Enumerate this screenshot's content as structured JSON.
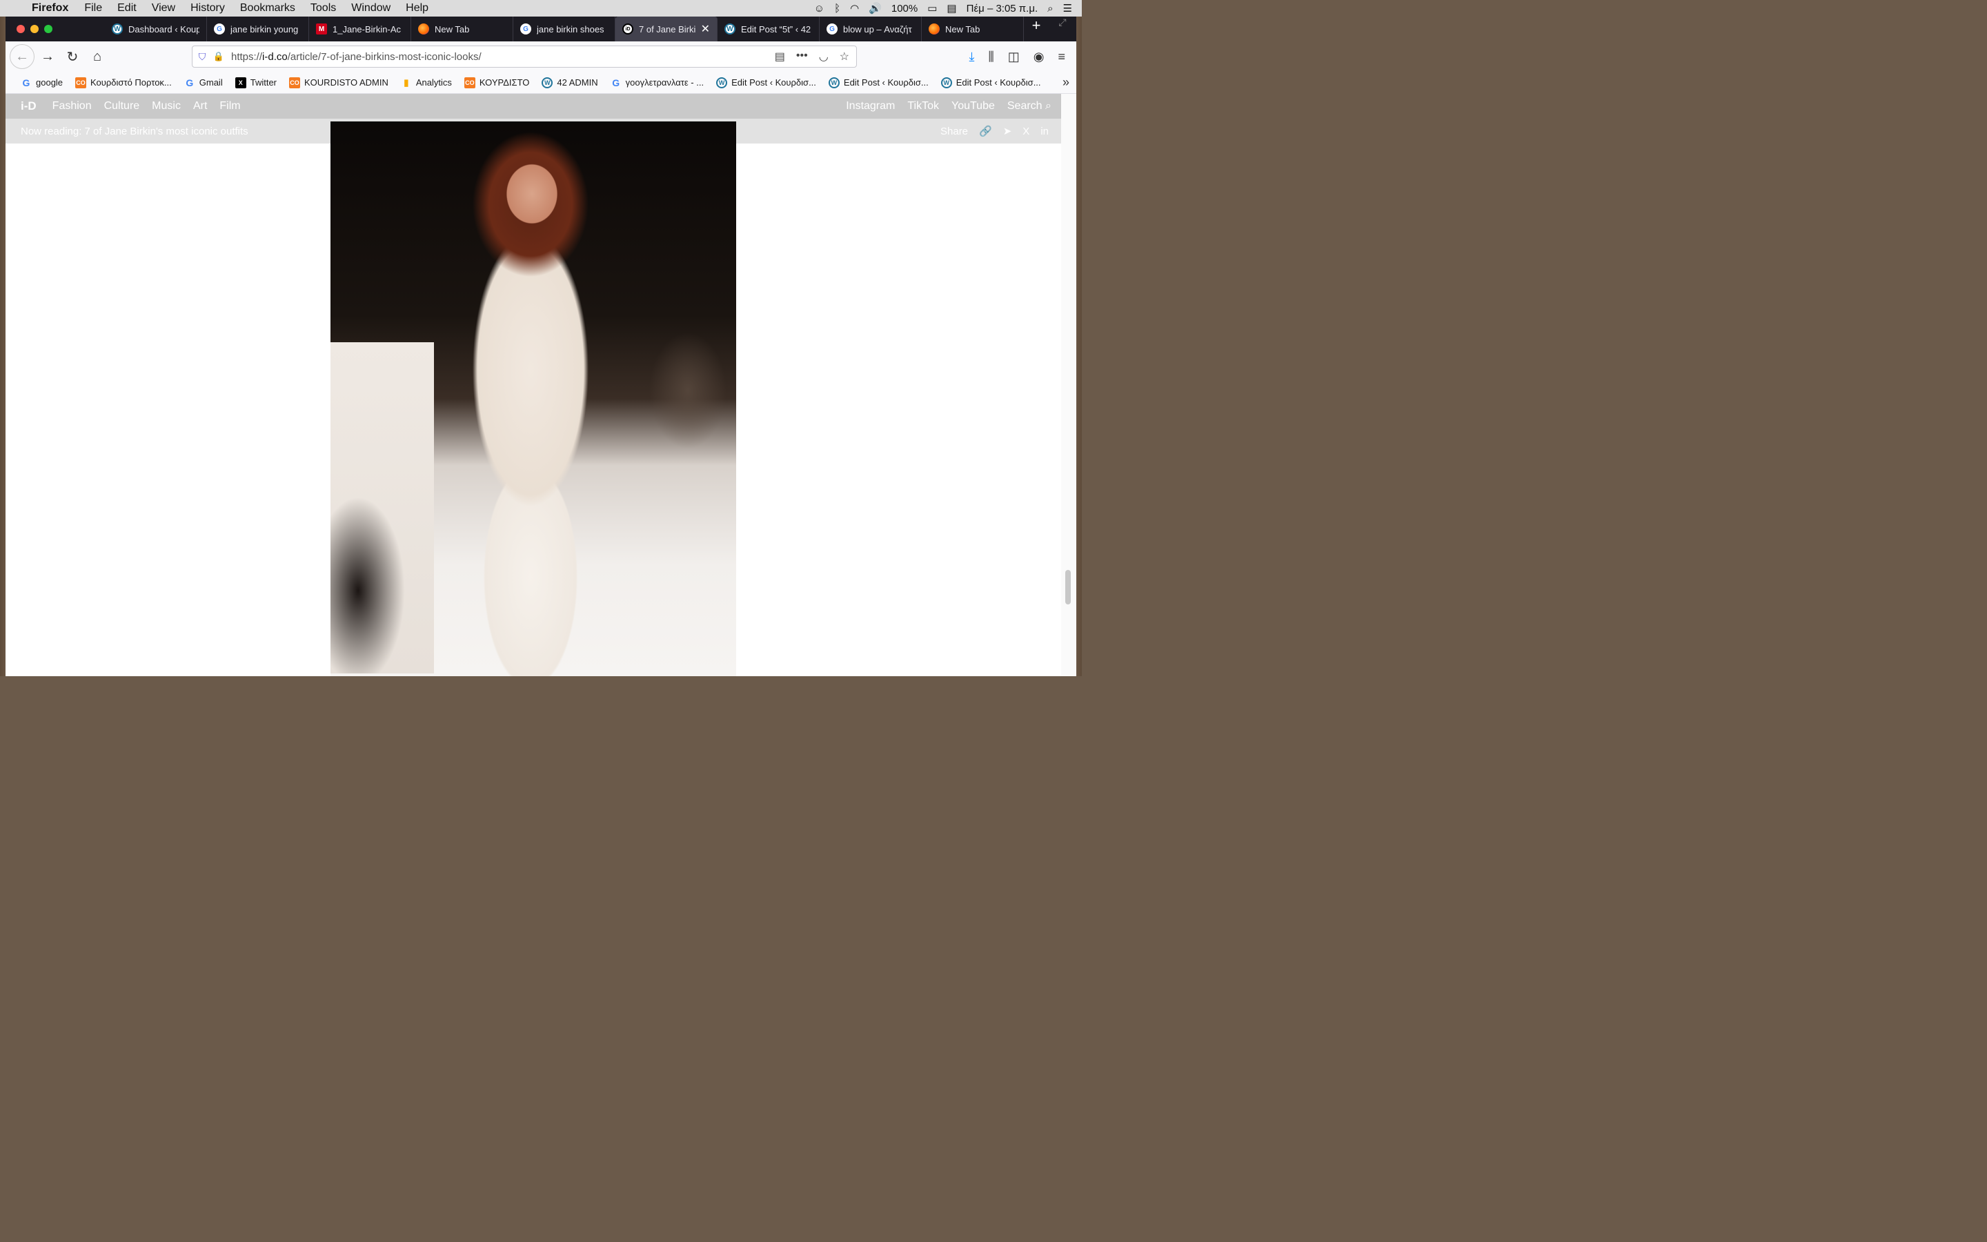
{
  "menubar": {
    "app": "Firefox",
    "items": [
      "File",
      "Edit",
      "View",
      "History",
      "Bookmarks",
      "Tools",
      "Window",
      "Help"
    ],
    "battery": "100%",
    "clock": "Πέμ – 3:05 π.μ."
  },
  "tabs": [
    {
      "label": "Dashboard ‹ Koup",
      "icon": "wordpress-icon"
    },
    {
      "label": "jane birkin young",
      "icon": "google-icon"
    },
    {
      "label": "1_Jane-Birkin-Ac",
      "icon": "m-icon"
    },
    {
      "label": "New Tab",
      "icon": "firefox-icon"
    },
    {
      "label": "jane birkin shoes",
      "icon": "google-icon"
    },
    {
      "label": "7 of Jane Birkin",
      "icon": "id-icon",
      "active": true
    },
    {
      "label": "Edit Post “5t” ‹ 42",
      "icon": "wordpress-icon"
    },
    {
      "label": "blow up – Αναζήτ",
      "icon": "google-icon"
    },
    {
      "label": "New Tab",
      "icon": "firefox-icon"
    }
  ],
  "url": {
    "scheme": "https://",
    "host": "i-d.co",
    "path": "/article/7-of-jane-birkins-most-iconic-looks/"
  },
  "bookmarks": [
    {
      "label": "google",
      "icon": "google"
    },
    {
      "label": "Κουρδιστό Πορτοκ...",
      "icon": "co"
    },
    {
      "label": "Gmail",
      "icon": "google"
    },
    {
      "label": "Twitter",
      "icon": "x"
    },
    {
      "label": "KOURDISTO ADMIN",
      "icon": "co"
    },
    {
      "label": "Analytics",
      "icon": "analytics"
    },
    {
      "label": "ΚΟΥΡΔΙΣΤΟ",
      "icon": "co"
    },
    {
      "label": "42 ADMIN",
      "icon": "wordpress"
    },
    {
      "label": "γοογλετρανλατε - ...",
      "icon": "google"
    },
    {
      "label": "Edit Post ‹ Κουρδισ...",
      "icon": "wordpress"
    },
    {
      "label": "Edit Post ‹ Κουρδισ...",
      "icon": "wordpress"
    },
    {
      "label": "Edit Post ‹ Κουρδισ...",
      "icon": "wordpress"
    }
  ],
  "site": {
    "logo": "i-D",
    "nav": [
      "Fashion",
      "Culture",
      "Music",
      "Art",
      "Film"
    ],
    "right": [
      "Instagram",
      "TikTok",
      "YouTube"
    ],
    "search": "Search",
    "reading": "Now reading: 7 of Jane Birkin's most iconic outfits",
    "share": "Share"
  }
}
